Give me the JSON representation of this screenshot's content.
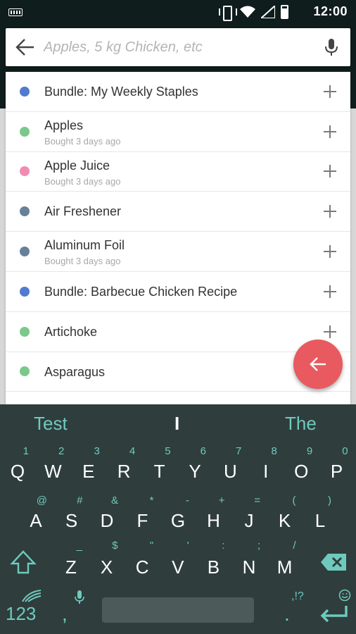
{
  "status_bar": {
    "time": "12:00"
  },
  "search": {
    "placeholder": "Apples, 5 kg Chicken, etc"
  },
  "suggestions": [
    {
      "name": "Bundle: My Weekly Staples",
      "subtitle": "",
      "color": "#4f7bd0"
    },
    {
      "name": "Apples",
      "subtitle": "Bought 3 days ago",
      "color": "#7bc98a"
    },
    {
      "name": "Apple Juice",
      "subtitle": "Bought 3 days ago",
      "color": "#f28bb2"
    },
    {
      "name": "Air Freshener",
      "subtitle": "",
      "color": "#68819a"
    },
    {
      "name": "Aluminum Foil",
      "subtitle": "Bought 3 days ago",
      "color": "#68819a"
    },
    {
      "name": "Bundle: Barbecue Chicken Recipe",
      "subtitle": "",
      "color": "#4f7bd0"
    },
    {
      "name": "Artichoke",
      "subtitle": "",
      "color": "#7bc98a"
    },
    {
      "name": "Asparagus",
      "subtitle": "",
      "color": "#7bc98a"
    }
  ],
  "keyboard": {
    "predictions": [
      "Test",
      "I",
      "The"
    ],
    "row1": {
      "keys": [
        "Q",
        "W",
        "E",
        "R",
        "T",
        "Y",
        "U",
        "I",
        "O",
        "P"
      ],
      "hints": [
        "1",
        "2",
        "3",
        "4",
        "5",
        "6",
        "7",
        "8",
        "9",
        "0"
      ]
    },
    "row2": {
      "keys": [
        "A",
        "S",
        "D",
        "F",
        "G",
        "H",
        "J",
        "K",
        "L"
      ],
      "hints": [
        "@",
        "#",
        "&",
        "*",
        "-",
        "+",
        "=",
        "(",
        ")"
      ]
    },
    "row3": {
      "keys": [
        "Z",
        "X",
        "C",
        "V",
        "B",
        "N",
        "M"
      ],
      "hints": [
        "_",
        "$",
        "\"",
        "'",
        ":",
        ";",
        "/"
      ]
    },
    "numbers_label": "123",
    "comma": ",",
    "period": ".",
    "punct_label": ",!?"
  },
  "colors": {
    "accent": "#6fcabd",
    "fab": "#e85a5f",
    "keyboard_bg": "#2f3d3d"
  }
}
